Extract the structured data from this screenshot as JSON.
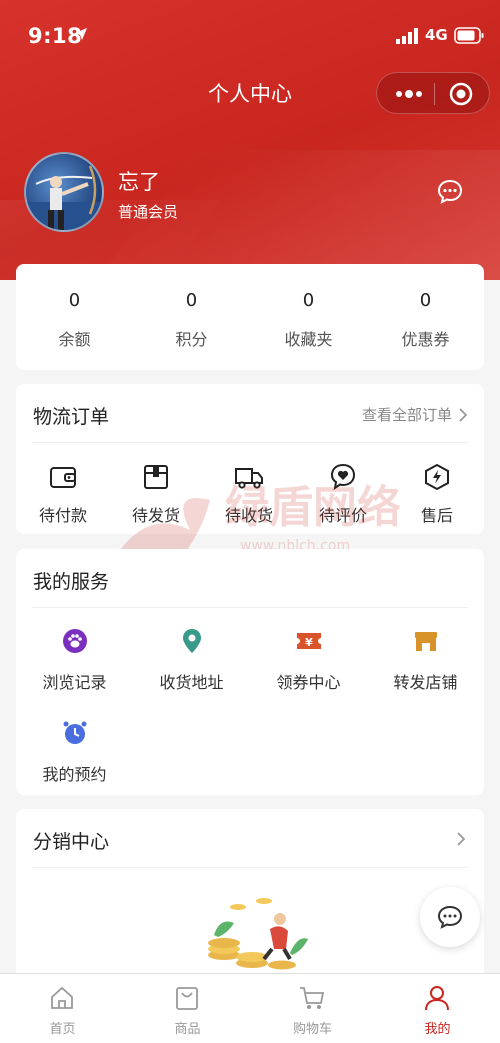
{
  "status_bar": {
    "time": "9:18",
    "network": "4G"
  },
  "nav": {
    "title": "个人中心"
  },
  "profile": {
    "name": "忘了",
    "level": "普通会员"
  },
  "stats": [
    {
      "value": "0",
      "label": "余额"
    },
    {
      "value": "0",
      "label": "积分"
    },
    {
      "value": "0",
      "label": "收藏夹"
    },
    {
      "value": "0",
      "label": "优惠券"
    }
  ],
  "orders": {
    "title": "物流订单",
    "view_all": "查看全部订单",
    "items": [
      {
        "label": "待付款",
        "icon": "wallet-icon"
      },
      {
        "label": "待发货",
        "icon": "box-icon"
      },
      {
        "label": "待收货",
        "icon": "truck-icon"
      },
      {
        "label": "待评价",
        "icon": "heart-chat-icon"
      },
      {
        "label": "售后",
        "icon": "lightning-shield-icon"
      }
    ]
  },
  "services": {
    "title": "我的服务",
    "items": [
      {
        "label": "浏览记录",
        "icon": "paw-icon",
        "color": "#7b2fbe"
      },
      {
        "label": "收货地址",
        "icon": "location-pin-icon",
        "color": "#3a9a8a"
      },
      {
        "label": "领券中心",
        "icon": "coupon-icon",
        "color": "#d9542b"
      },
      {
        "label": "转发店铺",
        "icon": "store-icon",
        "color": "#d9932b"
      },
      {
        "label": "我的预约",
        "icon": "alarm-clock-icon",
        "color": "#4a6de0"
      }
    ]
  },
  "distribution": {
    "title": "分销中心"
  },
  "watermark": {
    "text_cn": "绿盾网络",
    "text_url": "www.nblch.com"
  },
  "tabbar": [
    {
      "label": "首页",
      "icon": "home-icon"
    },
    {
      "label": "商品",
      "icon": "shopping-bag-icon"
    },
    {
      "label": "购物车",
      "icon": "cart-icon"
    },
    {
      "label": "我的",
      "icon": "user-icon",
      "active": true
    }
  ],
  "colors": {
    "primary": "#c8261f",
    "page_bg": "#f5f5f5"
  }
}
